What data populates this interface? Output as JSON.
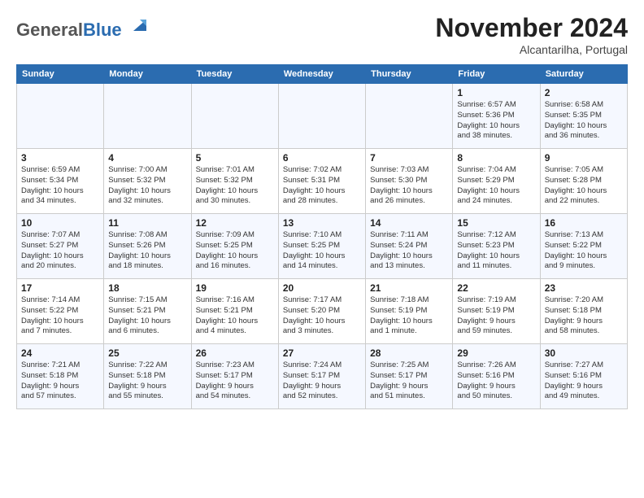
{
  "header": {
    "logo_general": "General",
    "logo_blue": "Blue",
    "month_title": "November 2024",
    "location": "Alcantarilha, Portugal"
  },
  "days_of_week": [
    "Sunday",
    "Monday",
    "Tuesday",
    "Wednesday",
    "Thursday",
    "Friday",
    "Saturday"
  ],
  "weeks": [
    [
      {
        "day": "",
        "info": ""
      },
      {
        "day": "",
        "info": ""
      },
      {
        "day": "",
        "info": ""
      },
      {
        "day": "",
        "info": ""
      },
      {
        "day": "",
        "info": ""
      },
      {
        "day": "1",
        "info": "Sunrise: 6:57 AM\nSunset: 5:36 PM\nDaylight: 10 hours\nand 38 minutes."
      },
      {
        "day": "2",
        "info": "Sunrise: 6:58 AM\nSunset: 5:35 PM\nDaylight: 10 hours\nand 36 minutes."
      }
    ],
    [
      {
        "day": "3",
        "info": "Sunrise: 6:59 AM\nSunset: 5:34 PM\nDaylight: 10 hours\nand 34 minutes."
      },
      {
        "day": "4",
        "info": "Sunrise: 7:00 AM\nSunset: 5:32 PM\nDaylight: 10 hours\nand 32 minutes."
      },
      {
        "day": "5",
        "info": "Sunrise: 7:01 AM\nSunset: 5:32 PM\nDaylight: 10 hours\nand 30 minutes."
      },
      {
        "day": "6",
        "info": "Sunrise: 7:02 AM\nSunset: 5:31 PM\nDaylight: 10 hours\nand 28 minutes."
      },
      {
        "day": "7",
        "info": "Sunrise: 7:03 AM\nSunset: 5:30 PM\nDaylight: 10 hours\nand 26 minutes."
      },
      {
        "day": "8",
        "info": "Sunrise: 7:04 AM\nSunset: 5:29 PM\nDaylight: 10 hours\nand 24 minutes."
      },
      {
        "day": "9",
        "info": "Sunrise: 7:05 AM\nSunset: 5:28 PM\nDaylight: 10 hours\nand 22 minutes."
      }
    ],
    [
      {
        "day": "10",
        "info": "Sunrise: 7:07 AM\nSunset: 5:27 PM\nDaylight: 10 hours\nand 20 minutes."
      },
      {
        "day": "11",
        "info": "Sunrise: 7:08 AM\nSunset: 5:26 PM\nDaylight: 10 hours\nand 18 minutes."
      },
      {
        "day": "12",
        "info": "Sunrise: 7:09 AM\nSunset: 5:25 PM\nDaylight: 10 hours\nand 16 minutes."
      },
      {
        "day": "13",
        "info": "Sunrise: 7:10 AM\nSunset: 5:25 PM\nDaylight: 10 hours\nand 14 minutes."
      },
      {
        "day": "14",
        "info": "Sunrise: 7:11 AM\nSunset: 5:24 PM\nDaylight: 10 hours\nand 13 minutes."
      },
      {
        "day": "15",
        "info": "Sunrise: 7:12 AM\nSunset: 5:23 PM\nDaylight: 10 hours\nand 11 minutes."
      },
      {
        "day": "16",
        "info": "Sunrise: 7:13 AM\nSunset: 5:22 PM\nDaylight: 10 hours\nand 9 minutes."
      }
    ],
    [
      {
        "day": "17",
        "info": "Sunrise: 7:14 AM\nSunset: 5:22 PM\nDaylight: 10 hours\nand 7 minutes."
      },
      {
        "day": "18",
        "info": "Sunrise: 7:15 AM\nSunset: 5:21 PM\nDaylight: 10 hours\nand 6 minutes."
      },
      {
        "day": "19",
        "info": "Sunrise: 7:16 AM\nSunset: 5:21 PM\nDaylight: 10 hours\nand 4 minutes."
      },
      {
        "day": "20",
        "info": "Sunrise: 7:17 AM\nSunset: 5:20 PM\nDaylight: 10 hours\nand 3 minutes."
      },
      {
        "day": "21",
        "info": "Sunrise: 7:18 AM\nSunset: 5:19 PM\nDaylight: 10 hours\nand 1 minute."
      },
      {
        "day": "22",
        "info": "Sunrise: 7:19 AM\nSunset: 5:19 PM\nDaylight: 9 hours\nand 59 minutes."
      },
      {
        "day": "23",
        "info": "Sunrise: 7:20 AM\nSunset: 5:18 PM\nDaylight: 9 hours\nand 58 minutes."
      }
    ],
    [
      {
        "day": "24",
        "info": "Sunrise: 7:21 AM\nSunset: 5:18 PM\nDaylight: 9 hours\nand 57 minutes."
      },
      {
        "day": "25",
        "info": "Sunrise: 7:22 AM\nSunset: 5:18 PM\nDaylight: 9 hours\nand 55 minutes."
      },
      {
        "day": "26",
        "info": "Sunrise: 7:23 AM\nSunset: 5:17 PM\nDaylight: 9 hours\nand 54 minutes."
      },
      {
        "day": "27",
        "info": "Sunrise: 7:24 AM\nSunset: 5:17 PM\nDaylight: 9 hours\nand 52 minutes."
      },
      {
        "day": "28",
        "info": "Sunrise: 7:25 AM\nSunset: 5:17 PM\nDaylight: 9 hours\nand 51 minutes."
      },
      {
        "day": "29",
        "info": "Sunrise: 7:26 AM\nSunset: 5:16 PM\nDaylight: 9 hours\nand 50 minutes."
      },
      {
        "day": "30",
        "info": "Sunrise: 7:27 AM\nSunset: 5:16 PM\nDaylight: 9 hours\nand 49 minutes."
      }
    ]
  ]
}
